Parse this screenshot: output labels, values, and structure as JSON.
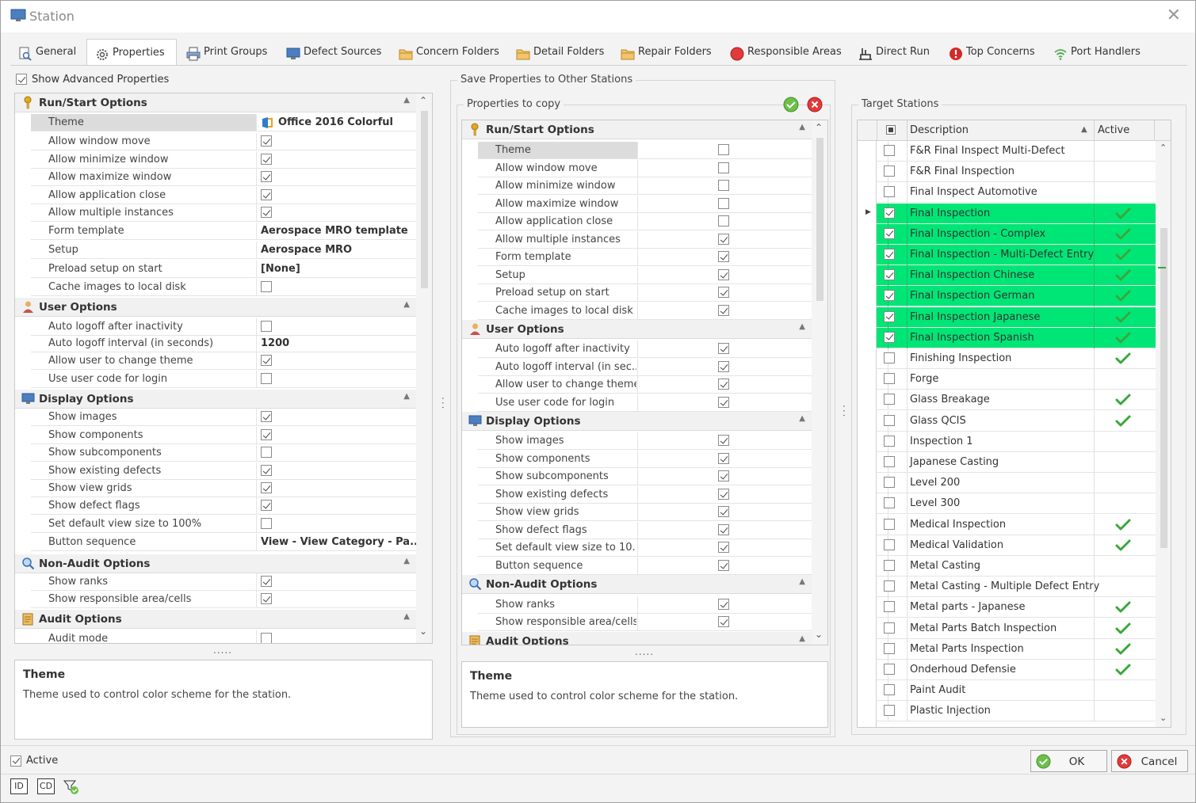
{
  "window": {
    "title": "Station"
  },
  "tabs": [
    {
      "label": "General",
      "icon": "search-doc-icon"
    },
    {
      "label": "Properties",
      "icon": "gears-icon"
    },
    {
      "label": "Print Groups",
      "icon": "printer-icon"
    },
    {
      "label": "Defect Sources",
      "icon": "monitor-icon"
    },
    {
      "label": "Concern Folders",
      "icon": "folder-icon"
    },
    {
      "label": "Detail Folders",
      "icon": "folder-icon"
    },
    {
      "label": "Repair Folders",
      "icon": "folder-icon"
    },
    {
      "label": "Responsible Areas",
      "icon": "red-circle-icon"
    },
    {
      "label": "Direct Run",
      "icon": "factory-icon"
    },
    {
      "label": "Top Concerns",
      "icon": "alert-icon"
    },
    {
      "label": "Port Handlers",
      "icon": "wifi-icon"
    }
  ],
  "show_advanced": {
    "label": "Show Advanced Properties",
    "checked": true
  },
  "left_grid": {
    "categories": [
      {
        "title": "Run/Start Options",
        "icon": "key-icon",
        "rows": [
          {
            "name": "Theme",
            "value": "Office 2016 Colorful",
            "type": "text",
            "selected": true
          },
          {
            "name": "Allow window move",
            "type": "check",
            "checked": true
          },
          {
            "name": "Allow minimize window",
            "type": "check",
            "checked": true
          },
          {
            "name": "Allow maximize window",
            "type": "check",
            "checked": true
          },
          {
            "name": "Allow application close",
            "type": "check",
            "checked": true
          },
          {
            "name": "Allow multiple instances",
            "type": "check",
            "checked": true
          },
          {
            "name": "Form template",
            "value": "Aerospace MRO template",
            "type": "text"
          },
          {
            "name": "Setup",
            "value": "Aerospace MRO",
            "type": "text"
          },
          {
            "name": "Preload setup on start",
            "value": "[None]",
            "type": "text"
          },
          {
            "name": "Cache images to local disk",
            "type": "check",
            "checked": false
          }
        ]
      },
      {
        "title": "User Options",
        "icon": "user-icon",
        "rows": [
          {
            "name": "Auto logoff after inactivity",
            "type": "check",
            "checked": false
          },
          {
            "name": "Auto logoff interval (in seconds)",
            "value": "1200",
            "type": "text"
          },
          {
            "name": "Allow user to change theme",
            "type": "check",
            "checked": true
          },
          {
            "name": "Use user code for login",
            "type": "check",
            "checked": false
          }
        ]
      },
      {
        "title": "Display Options",
        "icon": "display-icon",
        "rows": [
          {
            "name": "Show images",
            "type": "check",
            "checked": true
          },
          {
            "name": "Show components",
            "type": "check",
            "checked": true
          },
          {
            "name": "Show subcomponents",
            "type": "check",
            "checked": false
          },
          {
            "name": "Show existing defects",
            "type": "check",
            "checked": true
          },
          {
            "name": "Show view grids",
            "type": "check",
            "checked": true
          },
          {
            "name": "Show defect flags",
            "type": "check",
            "checked": true
          },
          {
            "name": "Set default view size to 100%",
            "type": "check",
            "checked": false
          },
          {
            "name": "Button sequence",
            "value": "View - View Category - Pa...",
            "type": "text"
          }
        ]
      },
      {
        "title": "Non-Audit Options",
        "icon": "magnifier-icon",
        "rows": [
          {
            "name": "Show ranks",
            "type": "check",
            "checked": true
          },
          {
            "name": "Show responsible area/cells",
            "type": "check",
            "checked": true
          }
        ]
      },
      {
        "title": "Audit Options",
        "icon": "audit-icon",
        "rows": [
          {
            "name": "Audit mode",
            "type": "check",
            "checked": false
          }
        ]
      }
    ]
  },
  "left_desc": {
    "title": "Theme",
    "text": "Theme used to control color scheme for the station."
  },
  "save_group": {
    "label": "Save Properties to Other Stations"
  },
  "props_to_copy": {
    "label": "Properties to copy",
    "categories": [
      {
        "title": "Run/Start Options",
        "icon": "key-icon",
        "rows": [
          {
            "name": "Theme",
            "checked": false,
            "selected": true
          },
          {
            "name": "Allow window move",
            "checked": false
          },
          {
            "name": "Allow minimize window",
            "checked": false
          },
          {
            "name": "Allow maximize window",
            "checked": false
          },
          {
            "name": "Allow application close",
            "checked": false
          },
          {
            "name": "Allow multiple instances",
            "checked": true
          },
          {
            "name": "Form template",
            "checked": true
          },
          {
            "name": "Setup",
            "checked": true
          },
          {
            "name": "Preload setup on start",
            "checked": true
          },
          {
            "name": "Cache images to local disk",
            "checked": true
          }
        ]
      },
      {
        "title": "User Options",
        "icon": "user-icon",
        "rows": [
          {
            "name": "Auto logoff after inactivity",
            "checked": true
          },
          {
            "name": "Auto logoff interval (in sec...",
            "checked": true
          },
          {
            "name": "Allow user to change theme",
            "checked": true
          },
          {
            "name": "Use user code for login",
            "checked": true
          }
        ]
      },
      {
        "title": "Display Options",
        "icon": "display-icon",
        "rows": [
          {
            "name": "Show images",
            "checked": true
          },
          {
            "name": "Show components",
            "checked": true
          },
          {
            "name": "Show subcomponents",
            "checked": true
          },
          {
            "name": "Show existing defects",
            "checked": true
          },
          {
            "name": "Show view grids",
            "checked": true
          },
          {
            "name": "Show defect flags",
            "checked": true
          },
          {
            "name": "Set default view size to 10...",
            "checked": true
          },
          {
            "name": "Button sequence",
            "checked": true
          }
        ]
      },
      {
        "title": "Non-Audit Options",
        "icon": "magnifier-icon",
        "rows": [
          {
            "name": "Show ranks",
            "checked": true
          },
          {
            "name": "Show responsible area/cells",
            "checked": true
          }
        ]
      },
      {
        "title": "Audit Options",
        "icon": "audit-icon",
        "rows": []
      }
    ]
  },
  "mid_desc": {
    "title": "Theme",
    "text": "Theme used to control color scheme for the station."
  },
  "target": {
    "label": "Target Stations",
    "col_description": "Description",
    "col_active": "Active",
    "rows": [
      {
        "desc": "F&R Final Inspect Multi-Defect",
        "checked": false,
        "active": false,
        "green": false
      },
      {
        "desc": "F&R Final Inspection",
        "checked": false,
        "active": false,
        "green": false
      },
      {
        "desc": "Final Inspect Automotive",
        "checked": false,
        "active": false,
        "green": false
      },
      {
        "desc": "Final Inspection",
        "checked": true,
        "active": true,
        "green": true
      },
      {
        "desc": "Final Inspection - Complex",
        "checked": true,
        "active": true,
        "green": true
      },
      {
        "desc": "Final Inspection - Multi-Defect Entry",
        "checked": true,
        "active": true,
        "green": true
      },
      {
        "desc": "Final Inspection Chinese",
        "checked": true,
        "active": true,
        "green": true
      },
      {
        "desc": "Final Inspection German",
        "checked": true,
        "active": true,
        "green": true
      },
      {
        "desc": "Final Inspection Japanese",
        "checked": true,
        "active": true,
        "green": true
      },
      {
        "desc": "Final Inspection Spanish",
        "checked": true,
        "active": true,
        "green": true
      },
      {
        "desc": "Finishing Inspection",
        "checked": false,
        "active": true,
        "green": false
      },
      {
        "desc": "Forge",
        "checked": false,
        "active": false,
        "green": false
      },
      {
        "desc": "Glass Breakage",
        "checked": false,
        "active": true,
        "green": false
      },
      {
        "desc": "Glass QCIS",
        "checked": false,
        "active": true,
        "green": false
      },
      {
        "desc": "Inspection 1",
        "checked": false,
        "active": false,
        "green": false
      },
      {
        "desc": "Japanese Casting",
        "checked": false,
        "active": false,
        "green": false
      },
      {
        "desc": "Level 200",
        "checked": false,
        "active": false,
        "green": false
      },
      {
        "desc": "Level 300",
        "checked": false,
        "active": false,
        "green": false
      },
      {
        "desc": "Medical Inspection",
        "checked": false,
        "active": true,
        "green": false
      },
      {
        "desc": "Medical Validation",
        "checked": false,
        "active": true,
        "green": false
      },
      {
        "desc": "Metal Casting",
        "checked": false,
        "active": false,
        "green": false
      },
      {
        "desc": "Metal Casting - Multiple Defect Entry",
        "checked": false,
        "active": false,
        "green": false
      },
      {
        "desc": "Metal parts - Japanese",
        "checked": false,
        "active": true,
        "green": false
      },
      {
        "desc": "Metal Parts Batch Inspection",
        "checked": false,
        "active": true,
        "green": false
      },
      {
        "desc": "Metal Parts Inspection",
        "checked": false,
        "active": true,
        "green": false
      },
      {
        "desc": "Onderhoud Defensie",
        "checked": false,
        "active": true,
        "green": false
      },
      {
        "desc": "Paint Audit",
        "checked": false,
        "active": false,
        "green": false
      },
      {
        "desc": "Plastic Injection",
        "checked": false,
        "active": false,
        "green": false
      }
    ]
  },
  "footer": {
    "active_label": "Active",
    "active_checked": true,
    "ok_label": "OK",
    "cancel_label": "Cancel",
    "id_label": "ID",
    "cd_label": "CD"
  },
  "colors": {
    "highlight_green": "#00e676",
    "active_check": "#3aa83a"
  }
}
